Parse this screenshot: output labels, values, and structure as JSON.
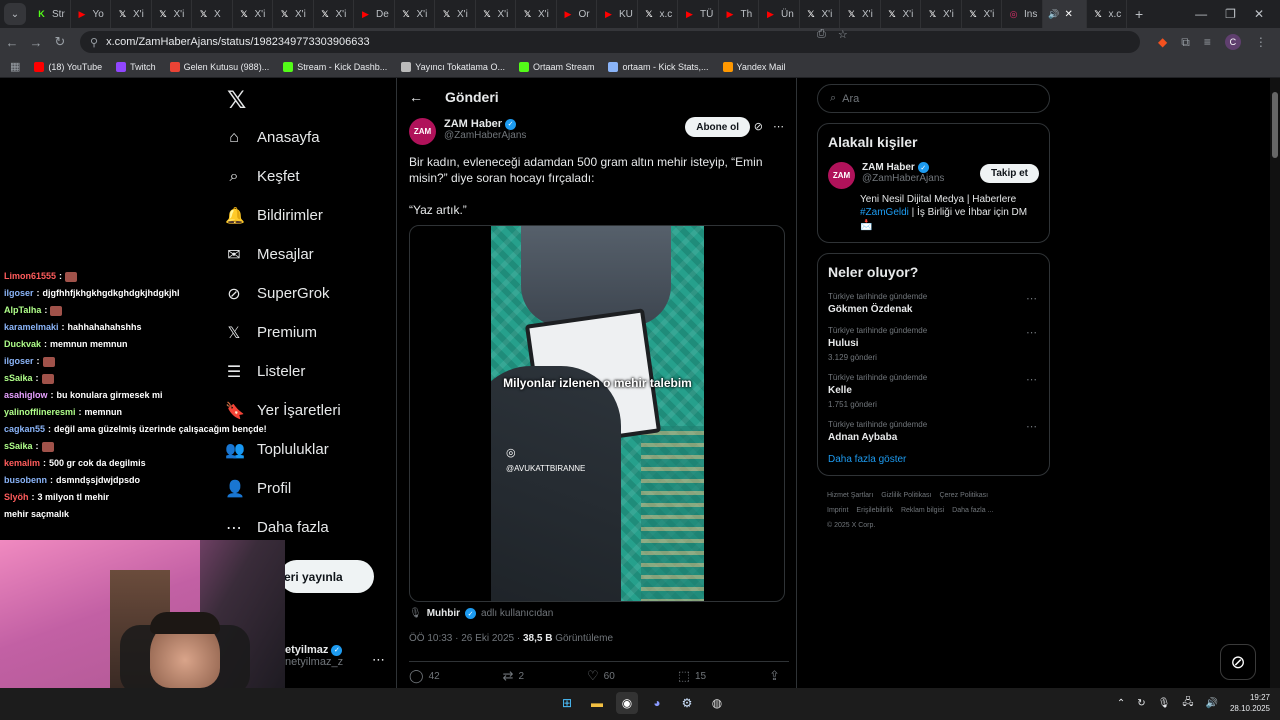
{
  "browser": {
    "tabs": [
      {
        "label": "Str",
        "icon": "kick-icon",
        "color": "#53fc18"
      },
      {
        "label": "Yo",
        "icon": "youtube-icon",
        "color": "#ff0000"
      },
      {
        "label": "X'i",
        "icon": "x-icon",
        "color": "#ffffff"
      },
      {
        "label": "X'i",
        "icon": "x-icon",
        "color": "#ffffff"
      },
      {
        "label": "X",
        "icon": "x-icon",
        "color": "#ffffff"
      },
      {
        "label": "X'i",
        "icon": "x-icon",
        "color": "#ffffff"
      },
      {
        "label": "X'i",
        "icon": "x-icon",
        "color": "#ffffff"
      },
      {
        "label": "X'i",
        "icon": "x-icon",
        "color": "#ffffff"
      },
      {
        "label": "De",
        "icon": "youtube-icon",
        "color": "#ff0000"
      },
      {
        "label": "X'i",
        "icon": "x-icon",
        "color": "#ffffff"
      },
      {
        "label": "X'i",
        "icon": "x-icon",
        "color": "#ffffff"
      },
      {
        "label": "X'i",
        "icon": "x-icon",
        "color": "#ffffff"
      },
      {
        "label": "X'i",
        "icon": "x-icon",
        "color": "#ffffff"
      },
      {
        "label": "Or",
        "icon": "youtube-icon",
        "color": "#ff0000"
      },
      {
        "label": "KU",
        "icon": "youtube-icon",
        "color": "#ff0000"
      },
      {
        "label": "x.c",
        "icon": "x-icon",
        "color": "#ffffff"
      },
      {
        "label": "TÜ",
        "icon": "youtube-icon",
        "color": "#ff0000"
      },
      {
        "label": "Th",
        "icon": "youtube-icon",
        "color": "#ff0000"
      },
      {
        "label": "Ün",
        "icon": "youtube-icon",
        "color": "#ff0000"
      },
      {
        "label": "X'i",
        "icon": "x-icon",
        "color": "#ffffff"
      },
      {
        "label": "X'i",
        "icon": "x-icon",
        "color": "#ffffff"
      },
      {
        "label": "X'i",
        "icon": "x-icon",
        "color": "#ffffff"
      },
      {
        "label": "X'i",
        "icon": "x-icon",
        "color": "#ffffff"
      },
      {
        "label": "X'i",
        "icon": "x-icon",
        "color": "#ffffff"
      },
      {
        "label": "Ins",
        "icon": "instagram-icon",
        "color": "#e1306c"
      }
    ],
    "active_tab": {
      "label": "x.c"
    },
    "url": "x.com/ZamHaberAjans/status/1982349773303906633",
    "bookmarks": [
      {
        "label": "(18) YouTube",
        "color": "#ff0000"
      },
      {
        "label": "Twitch",
        "color": "#9146ff"
      },
      {
        "label": "Gelen Kutusu (988)...",
        "color": "#ea4335"
      },
      {
        "label": "Stream - Kick Dashb...",
        "color": "#53fc18"
      },
      {
        "label": "Yayıncı Tokatlama O...",
        "color": "#bbbbbb"
      },
      {
        "label": "Ortaam Stream",
        "color": "#53fc18"
      },
      {
        "label": "ortaam - Kick Stats,...",
        "color": "#8ab4f8"
      },
      {
        "label": "Yandex Mail",
        "color": "#ff9800"
      }
    ],
    "profile_initial": "C"
  },
  "nav": {
    "items": [
      {
        "label": "Anasayfa",
        "icon": "home-icon",
        "glyph": "⌂"
      },
      {
        "label": "Keşfet",
        "icon": "search-icon",
        "glyph": "⌕"
      },
      {
        "label": "Bildirimler",
        "icon": "bell-icon",
        "glyph": "🔔"
      },
      {
        "label": "Mesajlar",
        "icon": "mail-icon",
        "glyph": "✉"
      },
      {
        "label": "SuperGrok",
        "icon": "grok-icon",
        "glyph": "⊘"
      },
      {
        "label": "Premium",
        "icon": "x-icon",
        "glyph": "𝕏"
      },
      {
        "label": "Listeler",
        "icon": "list-icon",
        "glyph": "☰"
      },
      {
        "label": "Yer İşaretleri",
        "icon": "bookmark-icon",
        "glyph": "🔖"
      },
      {
        "label": "Topluluklar",
        "icon": "community-icon",
        "glyph": "👥"
      },
      {
        "label": "Profil",
        "icon": "person-icon",
        "glyph": "👤"
      },
      {
        "label": "Daha fazla",
        "icon": "more-circle-icon",
        "glyph": "⋯"
      }
    ],
    "post_button": "eri yayınla",
    "profile": {
      "name": "etyilmaz",
      "handle": "netyilmaz_z"
    }
  },
  "chat": [
    {
      "user": "Limon61555",
      "color": "#ff5c5c",
      "text": "",
      "emote": true
    },
    {
      "user": "ilgoser",
      "color": "#8ab4f8",
      "text": "djgfhhfjkhgkhgdkghdgkjhdgkjhl",
      "emote": false
    },
    {
      "user": "AlpTalha",
      "color": "#b0ff8a",
      "text": "",
      "emote": true
    },
    {
      "user": "karamelmaki",
      "color": "#8ab4f8",
      "text": "hahhahahahshhs",
      "emote": false
    },
    {
      "user": "Duckvak",
      "color": "#b0ff8a",
      "text": "memnun memnun",
      "emote": false
    },
    {
      "user": "ilgoser",
      "color": "#8ab4f8",
      "text": "",
      "emote": true
    },
    {
      "user": "sSaika",
      "color": "#b0ff8a",
      "text": "",
      "emote": true
    },
    {
      "user": "asahiglow",
      "color": "#e7a1ff",
      "text": "bu konulara girmesek mi",
      "emote": false
    },
    {
      "user": "yalinofflineresmi",
      "color": "#b0ff8a",
      "text": "memnun",
      "emote": false
    },
    {
      "user": "cagkan55",
      "color": "#8ab4f8",
      "text": "değil ama güzelmiş üzerinde çalışacağım bençde!",
      "emote": false
    },
    {
      "user": "sSaika",
      "color": "#b0ff8a",
      "text": "",
      "emote": true
    },
    {
      "user": "kemalim",
      "color": "#ff5c5c",
      "text": "500 gr cok da degilmis",
      "emote": false
    },
    {
      "user": "busobenn",
      "color": "#8ab4f8",
      "text": "dsmndşsjdwjdpsdo",
      "emote": false
    },
    {
      "user": "Slyöh",
      "color": "#ff5c5c",
      "text": "3 milyon tl mehir",
      "emote": false
    },
    {
      "user": "mehir saçmalık",
      "color": "#ffffff",
      "text": "",
      "emote": false
    }
  ],
  "post": {
    "header_title": "Gönderi",
    "author": {
      "name": "ZAM Haber",
      "handle": "@ZamHaberAjans",
      "logo_text": "ZAM"
    },
    "follow_button": "Abone ol",
    "text": [
      "Bir kadın, evleneceği adamdan 500 gram altın mehir isteyip, “Emin misin?” diye soran hocayı fırçaladı:",
      "“Yaz artık.”"
    ],
    "video_caption": "Milyonlar izlenen o mehir talebim",
    "video_watermark": "@AVUKATTBIRANNE",
    "source": {
      "name": "Muhbir",
      "suffix": "adlı kullanıcıdan"
    },
    "meta": {
      "time": "ÖÖ 10:33 · 26 Eki 2025 ·",
      "views": "38,5 B",
      "views_label": "Görüntüleme"
    },
    "actions": [
      {
        "icon": "reply-icon",
        "glyph": "◯",
        "count": "42"
      },
      {
        "icon": "repost-icon",
        "glyph": "⇄",
        "count": "2"
      },
      {
        "icon": "heart-icon",
        "glyph": "♡",
        "count": "60"
      },
      {
        "icon": "bookmark-icon",
        "glyph": "⬚",
        "count": "15"
      },
      {
        "icon": "share-icon",
        "glyph": "⇪",
        "count": ""
      }
    ]
  },
  "sidebar": {
    "search_placeholder": "Ara",
    "related": {
      "title": "Alakalı kişiler",
      "name": "ZAM Haber",
      "handle": "@ZamHaberAjans",
      "button": "Takip et",
      "bio_pre": "Yeni Nesil Dijital Medya | Haberlere ",
      "bio_tag": "#ZamGeldi",
      "bio_post": " | İş Birliği ve İhbar için DM 📩"
    },
    "trends": {
      "title": "Neler oluyor?",
      "items": [
        {
          "context": "Türkiye tarihinde gündemde",
          "title": "Gökmen Özdenak",
          "count": ""
        },
        {
          "context": "Türkiye tarihinde gündemde",
          "title": "Hulusi",
          "count": "3.129 gönderi"
        },
        {
          "context": "Türkiye tarihinde gündemde",
          "title": "Kelle",
          "count": "1.751 gönderi"
        },
        {
          "context": "Türkiye tarihinde gündemde",
          "title": "Adnan Aybaba",
          "count": ""
        }
      ],
      "more": "Daha fazla göster"
    },
    "footer": [
      "Hizmet Şartları",
      "Gizlilik Politikası",
      "Çerez Politikası",
      "Imprint",
      "Erişilebilirlik",
      "Reklam bilgisi",
      "Daha fazla ...",
      "© 2025 X Corp."
    ]
  },
  "taskbar": {
    "time": "19:27",
    "date": "28.10.2025"
  }
}
